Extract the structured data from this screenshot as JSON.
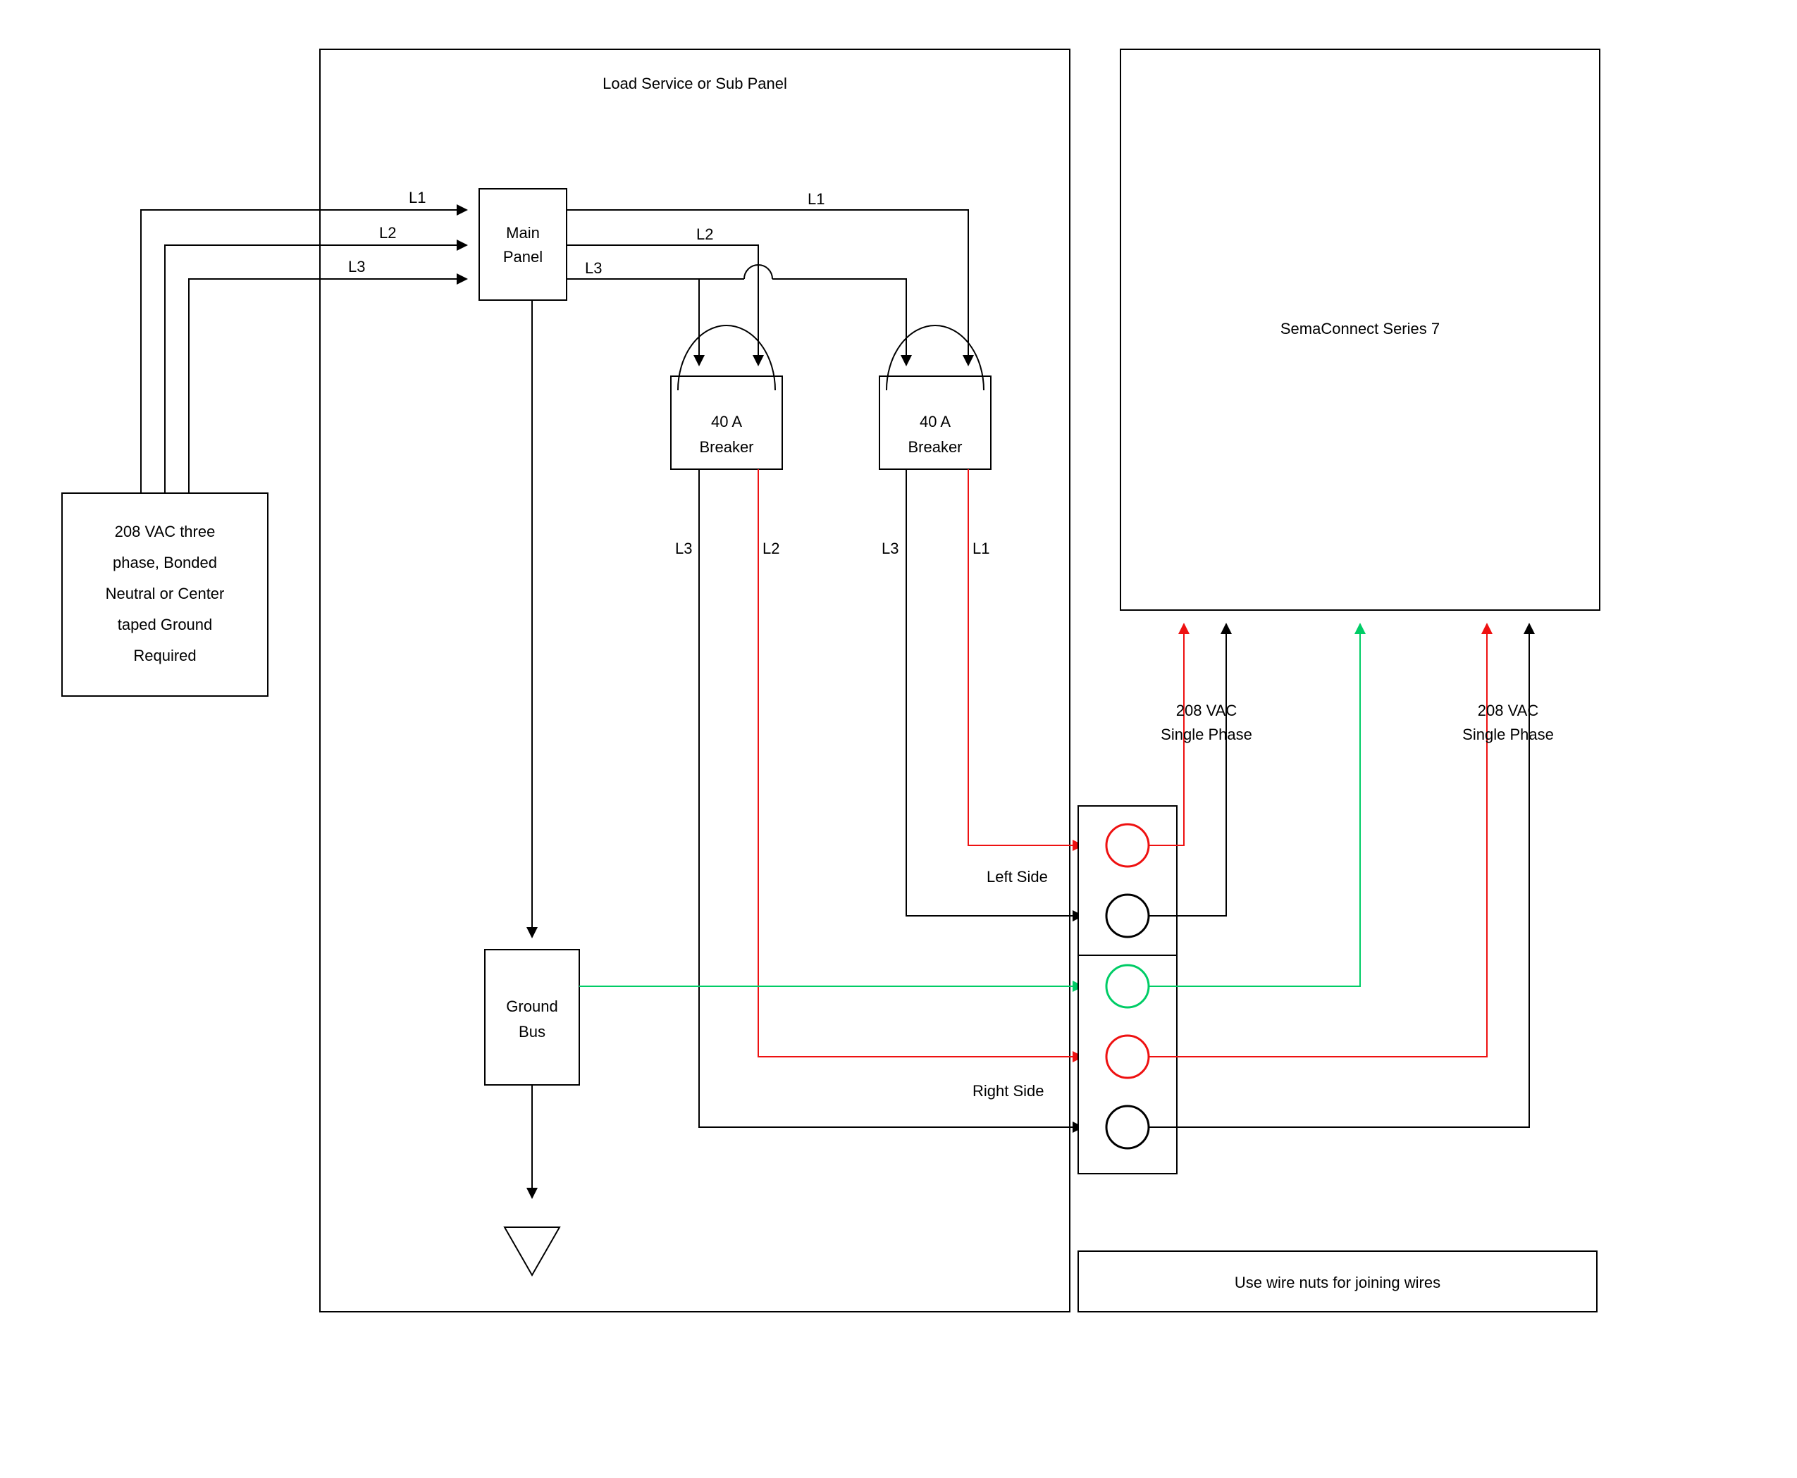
{
  "title": "Load Service or Sub Panel",
  "device": "SemaConnect Series 7",
  "source": {
    "l1": "208 VAC three",
    "l2": "phase, Bonded",
    "l3": "Neutral or Center",
    "l4": "taped Ground",
    "l5": "Required"
  },
  "mainpanel": {
    "l1": "Main",
    "l2": "Panel"
  },
  "breaker": {
    "l1": "40 A",
    "l2": "Breaker"
  },
  "groundbus": {
    "l1": "Ground",
    "l2": "Bus"
  },
  "wirenuts": "Use wire nuts for joining wires",
  "phaseA": {
    "l1": "208 VAC",
    "l2": "Single Phase"
  },
  "phaseB": {
    "l1": "208 VAC",
    "l2": "Single Phase"
  },
  "leftside": "Left Side",
  "rightside": "Right Side",
  "phase_labels": {
    "L1": "L1",
    "L2": "L2",
    "L3": "L3"
  }
}
